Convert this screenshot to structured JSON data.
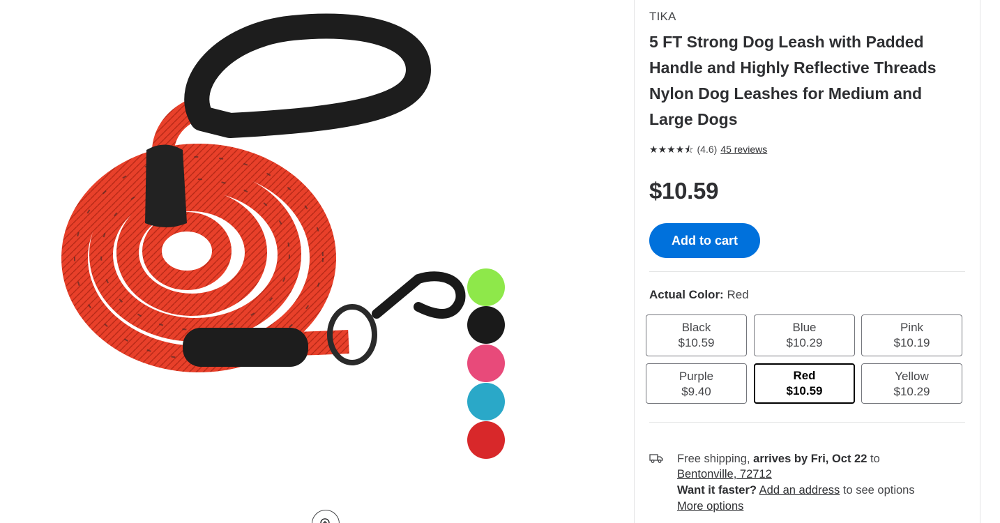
{
  "product": {
    "brand": "TIKA",
    "title": "5 FT Strong Dog Leash with Padded Handle and Highly Reflective Threads Nylon Dog Leashes for Medium and Large Dogs",
    "rating_value": "(4.6)",
    "reviews_link": "45 reviews",
    "rating_stars": 4.6,
    "price": "$10.59",
    "add_to_cart": "Add to cart"
  },
  "color": {
    "label": "Actual Color:",
    "selected": "Red",
    "variants": [
      {
        "name": "Black",
        "price": "$10.59"
      },
      {
        "name": "Blue",
        "price": "$10.29"
      },
      {
        "name": "Pink",
        "price": "$10.19"
      },
      {
        "name": "Purple",
        "price": "$9.40"
      },
      {
        "name": "Red",
        "price": "$10.59"
      },
      {
        "name": "Yellow",
        "price": "$10.29"
      }
    ]
  },
  "shipping": {
    "free": "Free shipping,",
    "arrives": "arrives by Fri, Oct 22",
    "to": "to",
    "location": "Bentonville, 72712",
    "want_faster": "Want it faster?",
    "add_address": "Add an address",
    "see_options": "to see options",
    "more_options": "More options"
  },
  "colors": {
    "accent": "#0071dc",
    "leash": "#e8402a",
    "swatches": [
      "#8ee84a",
      "#1a1a1a",
      "#e84a7a",
      "#2aa8c8",
      "#d8282a"
    ]
  },
  "icons": {
    "truck": "truck-icon",
    "zoom": "zoom-in-icon",
    "star": "star-icon"
  }
}
